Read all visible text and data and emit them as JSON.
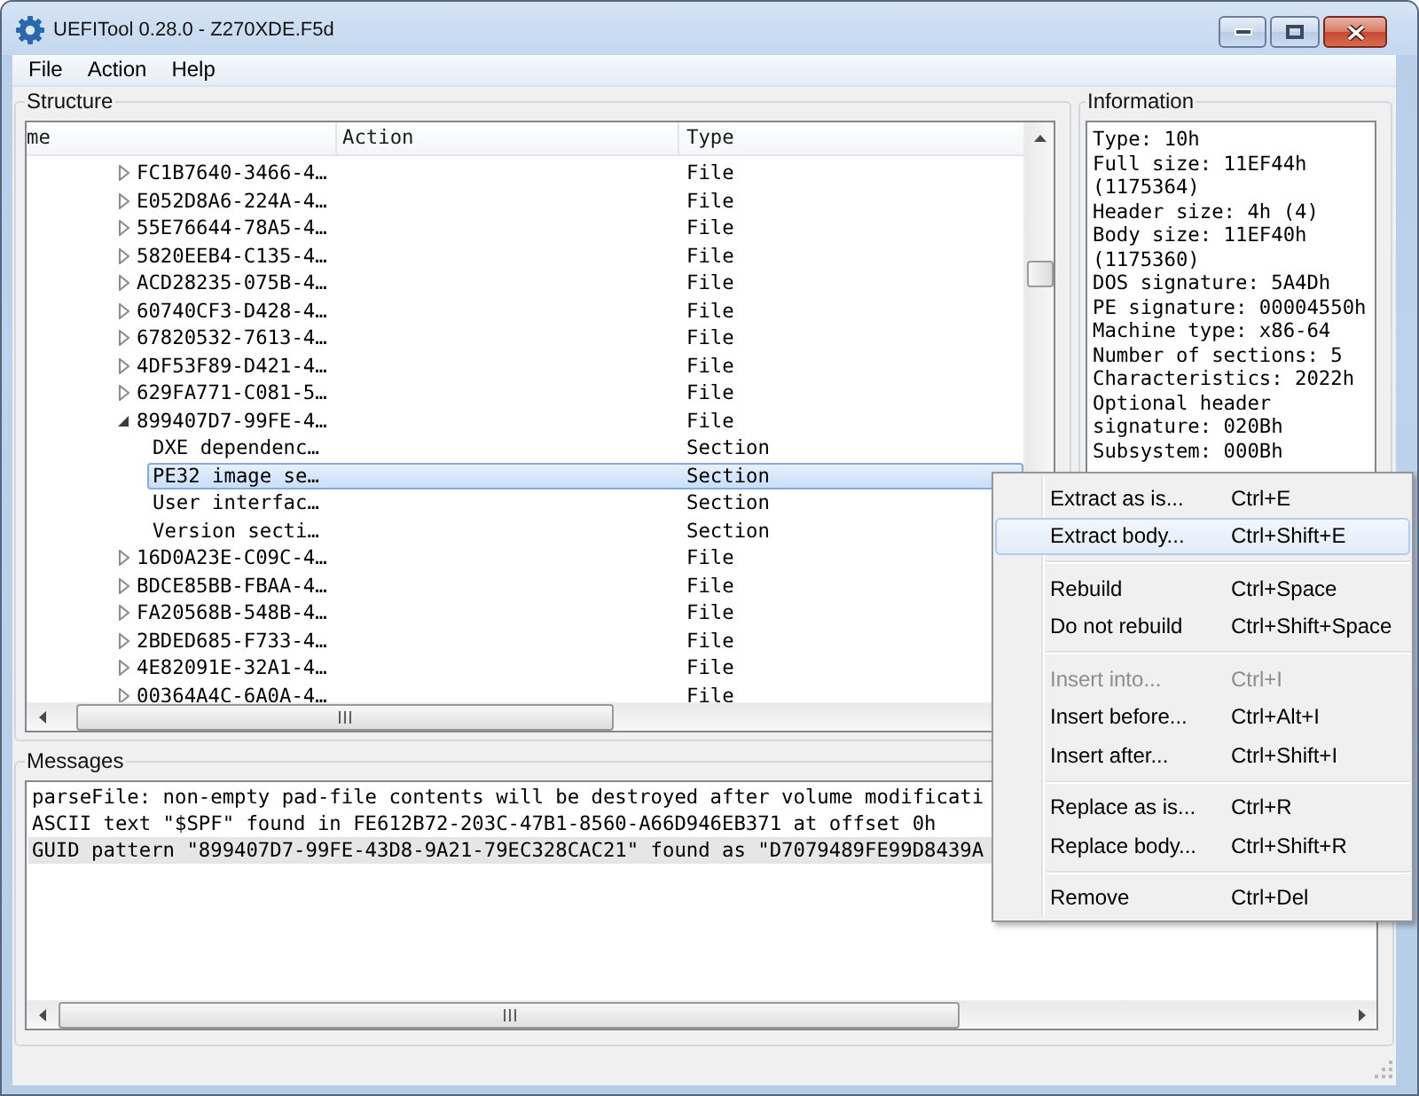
{
  "window": {
    "title": "UEFITool 0.28.0 - Z270XDE.F5d"
  },
  "menu_bar": [
    "File",
    "Action",
    "Help"
  ],
  "structure": {
    "title": "Structure",
    "columns": [
      "me",
      "Action",
      "Type"
    ],
    "items": [
      {
        "name": "FC1B7640-3466-4…",
        "type": "File",
        "expanded": false,
        "selected": false
      },
      {
        "name": "E052D8A6-224A-4…",
        "type": "File",
        "expanded": false,
        "selected": false
      },
      {
        "name": "55E76644-78A5-4…",
        "type": "File",
        "expanded": false,
        "selected": false
      },
      {
        "name": "5820EEB4-C135-4…",
        "type": "File",
        "expanded": false,
        "selected": false
      },
      {
        "name": "ACD28235-075B-4…",
        "type": "File",
        "expanded": false,
        "selected": false
      },
      {
        "name": "60740CF3-D428-4…",
        "type": "File",
        "expanded": false,
        "selected": false
      },
      {
        "name": "67820532-7613-4…",
        "type": "File",
        "expanded": false,
        "selected": false
      },
      {
        "name": "4DF53F89-D421-4…",
        "type": "File",
        "expanded": false,
        "selected": false
      },
      {
        "name": "629FA771-C081-5…",
        "type": "File",
        "expanded": false,
        "selected": false
      },
      {
        "name": "899407D7-99FE-4…",
        "type": "File",
        "expanded": true,
        "selected": false,
        "children": [
          {
            "name": "DXE dependenc…",
            "type": "Section",
            "selected": false
          },
          {
            "name": "PE32 image se…",
            "type": "Section",
            "selected": true
          },
          {
            "name": "User interfac…",
            "type": "Section",
            "selected": false
          },
          {
            "name": "Version secti…",
            "type": "Section",
            "selected": false
          }
        ]
      },
      {
        "name": "16D0A23E-C09C-4…",
        "type": "File",
        "expanded": false,
        "selected": false
      },
      {
        "name": "BDCE85BB-FBAA-4…",
        "type": "File",
        "expanded": false,
        "selected": false
      },
      {
        "name": "FA20568B-548B-4…",
        "type": "File",
        "expanded": false,
        "selected": false
      },
      {
        "name": "2BDED685-F733-4…",
        "type": "File",
        "expanded": false,
        "selected": false
      },
      {
        "name": "4E82091E-32A1-4…",
        "type": "File",
        "expanded": false,
        "selected": false
      },
      {
        "name": "00364A4C-6A0A-4…",
        "type": "File",
        "expanded": false,
        "selected": false
      }
    ]
  },
  "information": {
    "title": "Information",
    "lines": [
      "Type: 10h",
      "Full size: 11EF44h",
      "(1175364)",
      "Header size: 4h (4)",
      "Body size: 11EF40h",
      "(1175360)",
      "DOS signature: 5A4Dh",
      "PE signature: 00004550h",
      "Machine type: x86-64",
      "Number of sections: 5",
      "Characteristics: 2022h",
      "Optional header",
      "signature: 020Bh",
      "Subsystem: 000Bh"
    ]
  },
  "messages": {
    "title": "Messages",
    "lines": [
      {
        "text": "parseFile: non-empty pad-file contents will be destroyed after volume modificati",
        "selected": false
      },
      {
        "text": "ASCII text \"$SPF\" found in FE612B72-203C-47B1-8560-A66D946EB371 at offset 0h",
        "selected": false
      },
      {
        "text": "GUID pattern \"899407D7-99FE-43D8-9A21-79EC328CAC21\" found as \"D7079489FE99D8439A",
        "selected": true
      }
    ]
  },
  "context_menu": {
    "items": [
      {
        "kind": "item",
        "label": "Extract as is...",
        "shortcut": "Ctrl+E",
        "disabled": false,
        "selected": false
      },
      {
        "kind": "item",
        "label": "Extract body...",
        "shortcut": "Ctrl+Shift+E",
        "disabled": false,
        "selected": true
      },
      {
        "kind": "separator"
      },
      {
        "kind": "item",
        "label": "Rebuild",
        "shortcut": "Ctrl+Space",
        "disabled": false,
        "selected": false
      },
      {
        "kind": "item",
        "label": "Do not rebuild",
        "shortcut": "Ctrl+Shift+Space",
        "disabled": false,
        "selected": false
      },
      {
        "kind": "separator"
      },
      {
        "kind": "item",
        "label": "Insert into...",
        "shortcut": "Ctrl+I",
        "disabled": true,
        "selected": false
      },
      {
        "kind": "item",
        "label": "Insert before...",
        "shortcut": "Ctrl+Alt+I",
        "disabled": false,
        "selected": false
      },
      {
        "kind": "item",
        "label": "Insert after...",
        "shortcut": "Ctrl+Shift+I",
        "disabled": false,
        "selected": false
      },
      {
        "kind": "separator"
      },
      {
        "kind": "item",
        "label": "Replace as is...",
        "shortcut": "Ctrl+R",
        "disabled": false,
        "selected": false
      },
      {
        "kind": "item",
        "label": "Replace body...",
        "shortcut": "Ctrl+Shift+R",
        "disabled": false,
        "selected": false
      },
      {
        "kind": "separator"
      },
      {
        "kind": "item",
        "label": "Remove",
        "shortcut": "Ctrl+Del",
        "disabled": false,
        "selected": false
      }
    ]
  }
}
